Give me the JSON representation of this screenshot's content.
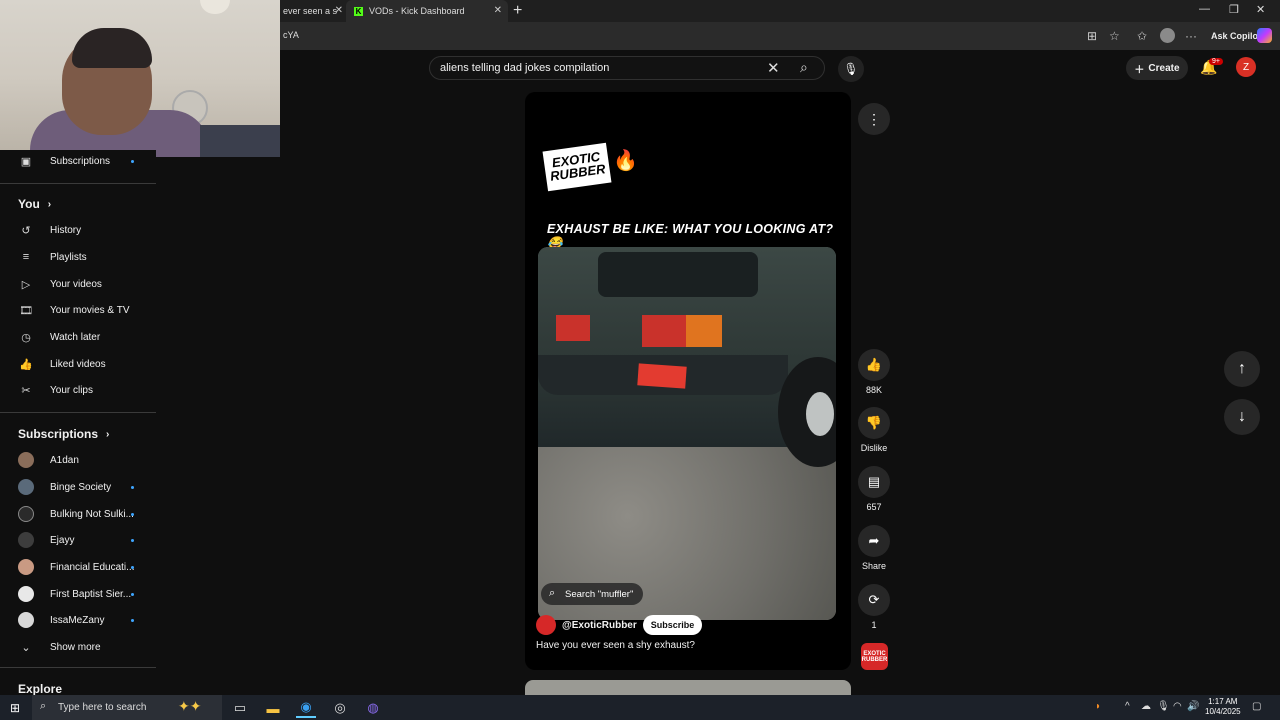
{
  "browser": {
    "tabs": [
      {
        "label": "ever seen a s"
      },
      {
        "label": "VODs - Kick Dashboard"
      }
    ],
    "url_fragment": "cYA",
    "copilot_label": "Ask Copilot"
  },
  "header": {
    "search_value": "aliens telling dad jokes compilation",
    "create_label": "Create",
    "notification_count": "9+",
    "avatar_letter": "Z"
  },
  "sidebar": {
    "subscriptions_top_label": "Subscriptions",
    "you_label": "You",
    "you_items": [
      {
        "label": "History",
        "icon": "history-icon"
      },
      {
        "label": "Playlists",
        "icon": "playlists-icon"
      },
      {
        "label": "Your videos",
        "icon": "your-videos-icon"
      },
      {
        "label": "Your movies & TV",
        "icon": "movies-icon"
      },
      {
        "label": "Watch later",
        "icon": "watch-later-icon"
      },
      {
        "label": "Liked videos",
        "icon": "like-icon"
      },
      {
        "label": "Your clips",
        "icon": "scissors-icon"
      }
    ],
    "subscriptions_label": "Subscriptions",
    "channels": [
      {
        "name": "A1dan",
        "new": false
      },
      {
        "name": "Binge Society",
        "new": true
      },
      {
        "name": "Bulking Not Sulki...",
        "new": true
      },
      {
        "name": "Ejayy",
        "new": true
      },
      {
        "name": "Financial Educati...",
        "new": true
      },
      {
        "name": "First Baptist Sier...",
        "new": true
      },
      {
        "name": "IssaMeZany",
        "new": true
      }
    ],
    "show_more_label": "Show more",
    "explore_label": "Explore"
  },
  "short": {
    "brand_text": "EXOTIC RUBBER",
    "caption": "EXHAUST BE LIKE: WHAT YOU LOOKING AT? 😂",
    "search_chip": "Search \"muffler\"",
    "channel": "@ExoticRubber",
    "subscribe_label": "Subscribe",
    "description": "Have you ever seen a shy exhaust?"
  },
  "actions": {
    "likes": "88K",
    "dislike_label": "Dislike",
    "comments": "657",
    "share_label": "Share",
    "remix_count": "1",
    "sound_thumb_text": "EXOTIC RUBBER"
  },
  "taskbar": {
    "search_placeholder": "Type here to search",
    "time": "1:17 AM",
    "date": "10/4/2025"
  }
}
